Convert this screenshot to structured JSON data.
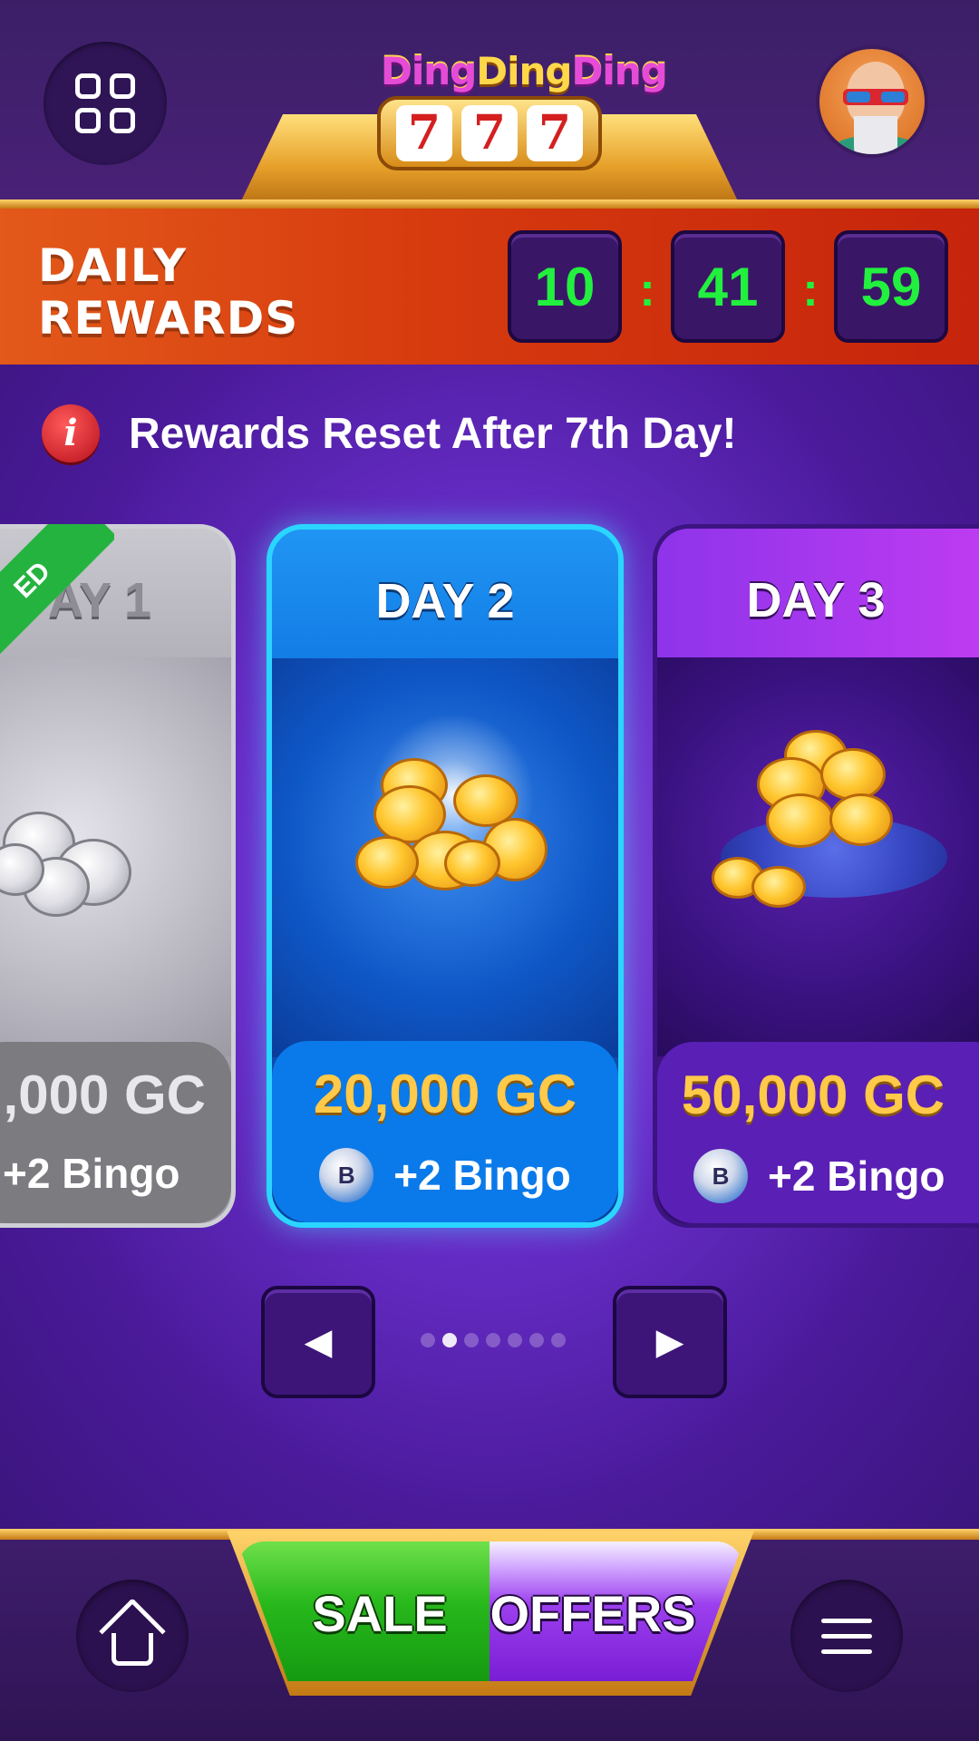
{
  "header": {
    "logo_text_1": "Ding",
    "logo_text_2": "Ding",
    "logo_text_3": "Ding",
    "logo_reels": [
      "7",
      "7",
      "7"
    ]
  },
  "daily_rewards": {
    "title_line1": "DAILY",
    "title_line2": "REWARDS",
    "timer": {
      "hours": "10",
      "minutes": "41",
      "seconds": "59",
      "separator": ":"
    }
  },
  "notice": {
    "icon_glyph": "i",
    "text": "Rewards Reset After 7th Day!"
  },
  "cards": [
    {
      "day": "AY 1",
      "amount": ",000 GC",
      "bingo": "+2 Bingo",
      "ribbon": "ED",
      "state": "claimed"
    },
    {
      "day": "DAY 2",
      "amount": "20,000 GC",
      "bingo": "+2 Bingo",
      "bingo_ball": "B",
      "state": "current"
    },
    {
      "day": "DAY 3",
      "amount": "50,000 GC",
      "bingo": "+2 Bingo",
      "bingo_ball": "B",
      "state": "upcoming"
    }
  ],
  "pager": {
    "prev_glyph": "◀",
    "next_glyph": "▶",
    "total_pages": 7,
    "active_page": 2
  },
  "bottom_nav": {
    "sale_label": "SALE",
    "offers_label": "OFFERS"
  },
  "colors": {
    "timer_green": "#22f03e",
    "gold_amount": "#ffc94a",
    "banner_orange": "#d63a0e",
    "current_card_border": "#2ad6ff"
  },
  "icons": {
    "top_left": "grid-icon",
    "top_right": "avatar",
    "bottom_left": "home-icon",
    "bottom_right": "menu-icon"
  }
}
